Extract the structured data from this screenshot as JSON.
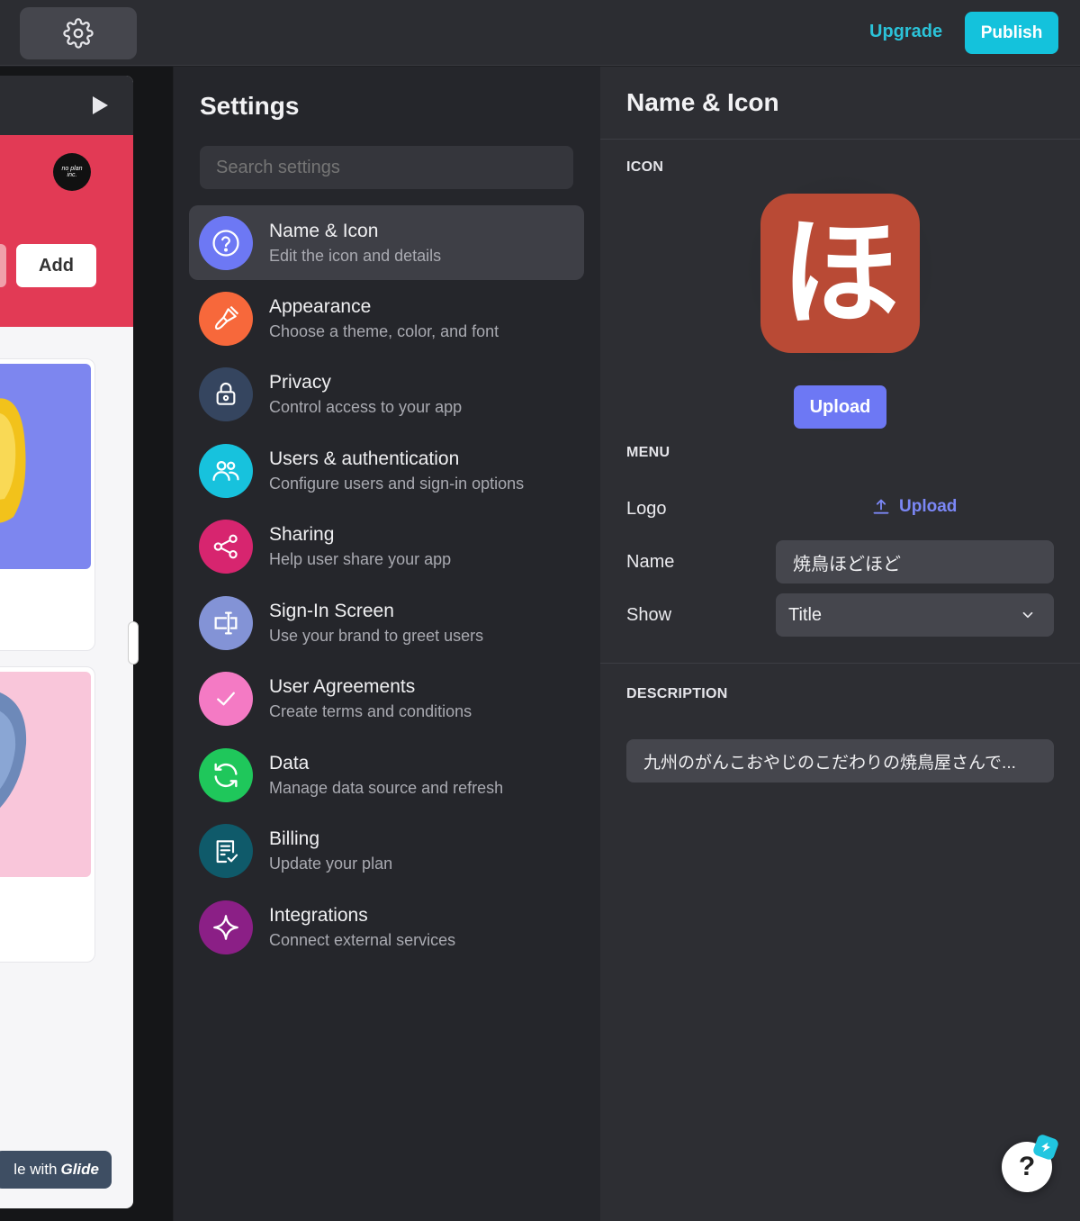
{
  "topbar": {
    "settings_icon": "gear-icon",
    "upgrade_label": "Upgrade",
    "publish_label": "Publish"
  },
  "preview": {
    "play_icon": "play-icon",
    "logo_text": "no plan inc.",
    "add_label": "Add",
    "made_with_prefix": "le with",
    "made_with_brand": "Glide"
  },
  "settings": {
    "title": "Settings",
    "search_placeholder": "Search settings",
    "items": [
      {
        "label": "Name & Icon",
        "sub": "Edit the icon and details",
        "icon": "question-circle-icon",
        "color": "#6d78f4",
        "active": true
      },
      {
        "label": "Appearance",
        "sub": "Choose a theme, color, and font",
        "icon": "paintbrush-icon",
        "color": "#f7683b"
      },
      {
        "label": "Privacy",
        "sub": "Control access to your app",
        "icon": "lock-icon",
        "color": "#35455f"
      },
      {
        "label": "Users & authentication",
        "sub": "Configure users and sign-in options",
        "icon": "users-icon",
        "color": "#17c2dd"
      },
      {
        "label": "Sharing",
        "sub": "Help user share your app",
        "icon": "share-icon",
        "color": "#d7256f"
      },
      {
        "label": "Sign-In Screen",
        "sub": "Use your brand to greet users",
        "icon": "sign-in-icon",
        "color": "#8393d6"
      },
      {
        "label": "User Agreements",
        "sub": "Create terms and conditions",
        "icon": "checkmark-icon",
        "color": "#f47ac4"
      },
      {
        "label": "Data",
        "sub": "Manage data source and refresh",
        "icon": "refresh-icon",
        "color": "#1fc75b"
      },
      {
        "label": "Billing",
        "sub": "Update your plan",
        "icon": "invoice-icon",
        "color": "#0f5a6a"
      },
      {
        "label": "Integrations",
        "sub": "Connect external services",
        "icon": "sparkle-icon",
        "color": "#8b1f86"
      }
    ]
  },
  "detail": {
    "title": "Name & Icon",
    "icon_section": "ICON",
    "app_icon_glyph": "ほ",
    "app_icon_color": "#b94a35",
    "upload_label": "Upload",
    "menu_section": "MENU",
    "logo_label": "Logo",
    "logo_upload_label": "Upload",
    "name_label": "Name",
    "name_value": "焼鳥ほどほど",
    "show_label": "Show",
    "show_value": "Title",
    "description_section": "DESCRIPTION",
    "description_value": "九州のがんこおやじのこだわりの焼鳥屋さんで..."
  },
  "help": {
    "label": "?"
  }
}
